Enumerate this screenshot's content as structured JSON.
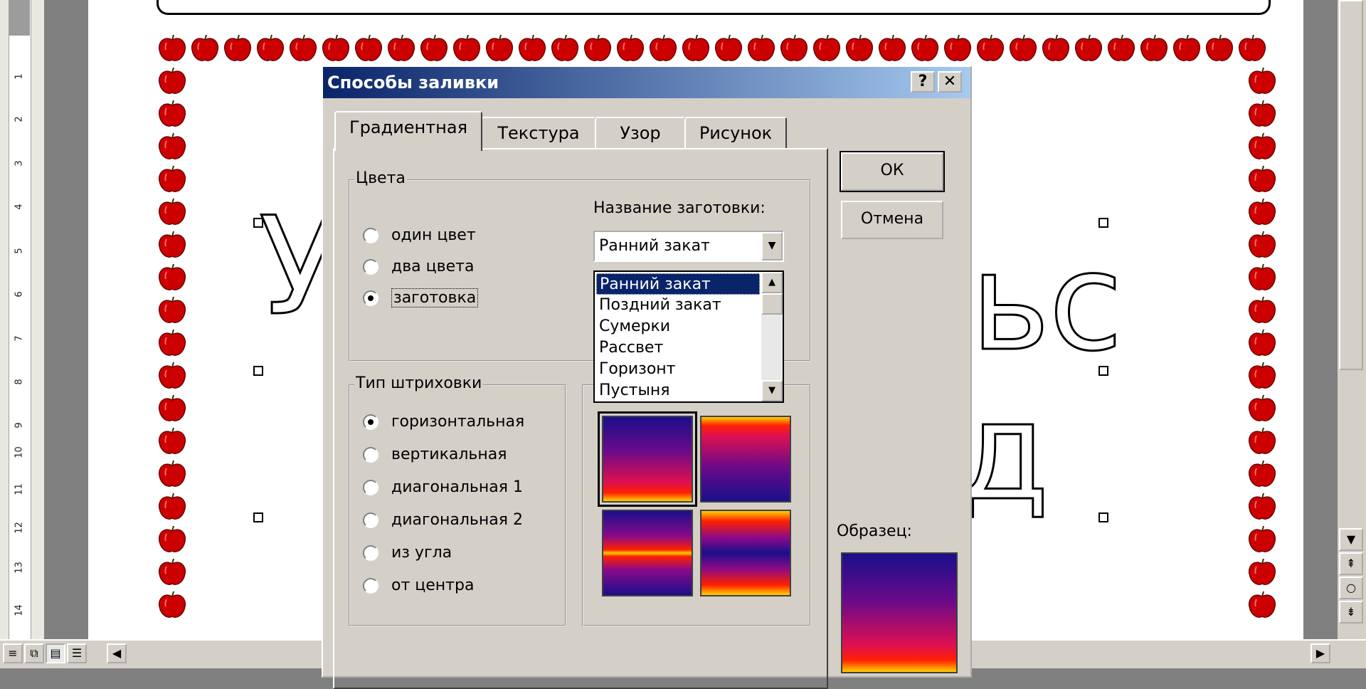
{
  "document": {
    "ruler_numbers": [
      "1",
      "2",
      "3",
      "4",
      "5",
      "6",
      "7",
      "8",
      "9",
      "10",
      "11",
      "12",
      "13",
      "14"
    ],
    "wordart_visible_letters": [
      "У",
      "ь",
      "с",
      "д"
    ]
  },
  "dialog": {
    "title": "Способы заливки",
    "help_button": "?",
    "close_button": "✕",
    "tabs": [
      {
        "label": "Градиентная",
        "active": true
      },
      {
        "label": "Текстура",
        "active": false
      },
      {
        "label": "Узор",
        "active": false
      },
      {
        "label": "Рисунок",
        "active": false
      }
    ],
    "colors_group": {
      "label": "Цвета",
      "options": [
        {
          "label": "один цвет",
          "selected": false
        },
        {
          "label": "два цвета",
          "selected": false
        },
        {
          "label": "заготовка",
          "selected": true
        }
      ]
    },
    "preset": {
      "label": "Название заготовки:",
      "value": "Ранний закат",
      "list": [
        "Ранний закат",
        "Поздний закат",
        "Сумерки",
        "Рассвет",
        "Горизонт",
        "Пустыня"
      ],
      "selected_index": 0
    },
    "shading_group": {
      "label": "Тип штриховки",
      "options": [
        {
          "label": "горизонтальная",
          "selected": true
        },
        {
          "label": "вертикальная",
          "selected": false
        },
        {
          "label": "диагональная 1",
          "selected": false
        },
        {
          "label": "диагональная 2",
          "selected": false
        },
        {
          "label": "из угла",
          "selected": false
        },
        {
          "label": "от центра",
          "selected": false
        }
      ]
    },
    "variants": {
      "selected_index": 0,
      "colors": [
        "#1a0f8a",
        "#6a0a8a",
        "#e01050",
        "#ff2000",
        "#ffd000"
      ]
    },
    "ok_label": "ОК",
    "cancel_label": "Отмена",
    "sample_label": "Образец:"
  },
  "colors": {
    "titlebar_start": "#0a246a",
    "titlebar_end": "#a6caf0",
    "dialog_face": "#d4d0c8",
    "apple_red": "#cc0000"
  }
}
